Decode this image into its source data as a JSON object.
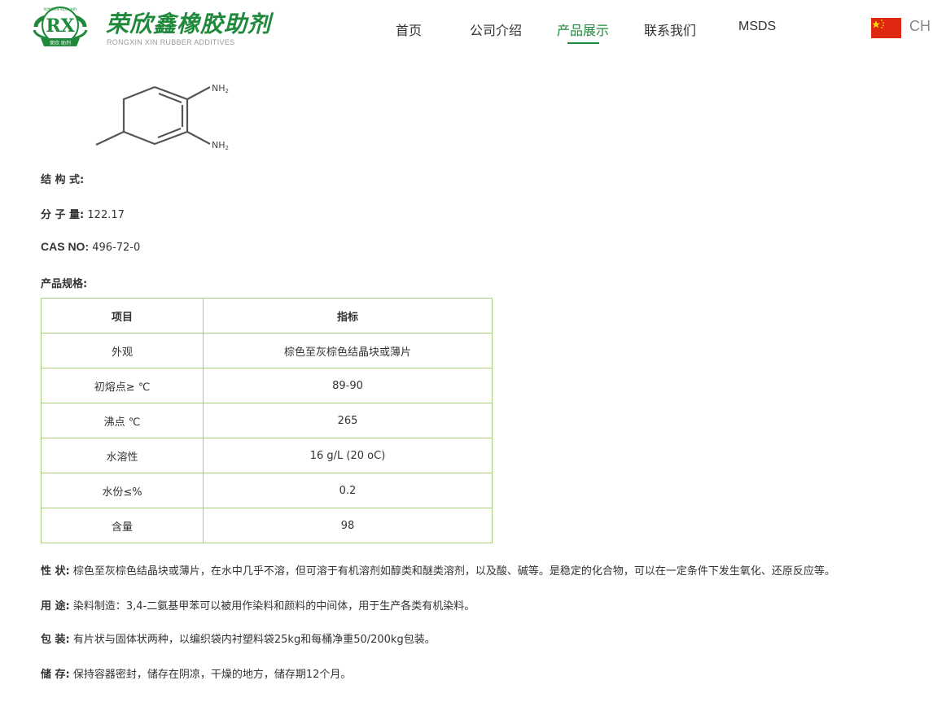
{
  "header": {
    "brand_cn": "荣欣鑫橡胶助剂",
    "brand_en": "RONGXIN XIN RUBBER ADDITIVES",
    "logo_text": "RX",
    "logo_ring_text": "RONGXIN AUXILIARY",
    "logo_ribbon_text": "荣欣 助剂",
    "nav": [
      {
        "label": "首页",
        "active": false
      },
      {
        "label": "公司介绍",
        "active": false
      },
      {
        "label": "产品展示",
        "active": true
      },
      {
        "label": "联系我们",
        "active": false
      },
      {
        "label": "MSDS",
        "active": false
      }
    ],
    "language": "CH",
    "accent_color": "#1f8a3c"
  },
  "molecule": {
    "label_top": "NH",
    "label_bottom": "NH",
    "subscript": "2"
  },
  "product": {
    "structure_label": "结 构 式:",
    "mw_label": "分 子 量:",
    "mw_value": "122.17",
    "cas_label": "CAS  NO:",
    "cas_value": "496-72-0",
    "spec_label": "产品规格:",
    "spec_table": {
      "headers": [
        "项目",
        "指标"
      ],
      "rows": [
        [
          "外观",
          "棕色至灰棕色结晶块或薄片"
        ],
        [
          "初熔点≥ ℃",
          "89-90"
        ],
        [
          "沸点 ℃",
          "265"
        ],
        [
          "水溶性",
          "16 g/L (20 oC)"
        ],
        [
          "水份≤%",
          "0.2"
        ],
        [
          "含量",
          "98"
        ]
      ]
    },
    "property_label": "性  状:",
    "property_value": "棕色至灰棕色结晶块或薄片，在水中几乎不溶，但可溶于有机溶剂如醇类和醚类溶剂，以及酸、碱等。是稳定的化合物，可以在一定条件下发生氧化、还原反应等。",
    "usage_label": "用  途:",
    "usage_value": "染料制造：3,4-二氨基甲苯可以被用作染料和颜料的中间体，用于生产各类有机染料。",
    "package_label": "包  装:",
    "package_value": "有片状与固体状两种，以编织袋内衬塑料袋25kg和每桶净重50/200kg包装。",
    "storage_label": "储  存:",
    "storage_value": "保持容器密封，储存在阴凉，干燥的地方，储存期12个月。"
  }
}
